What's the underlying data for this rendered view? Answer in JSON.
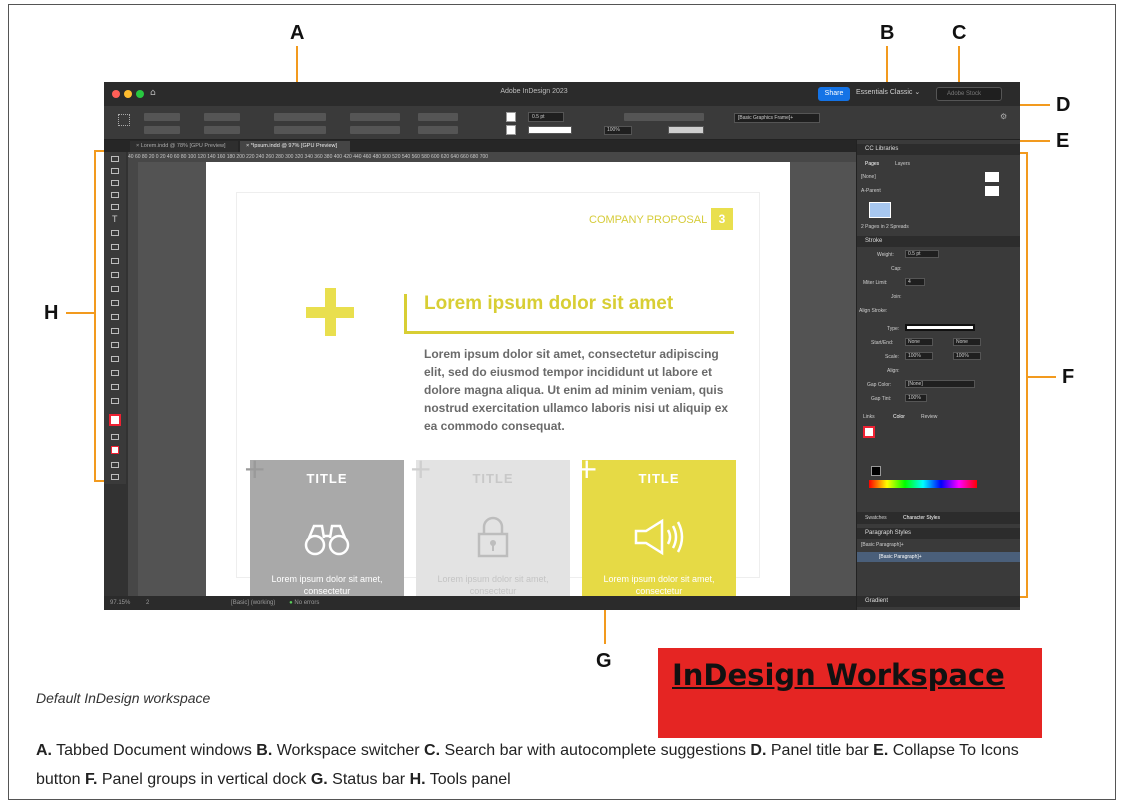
{
  "callouts": {
    "a": "A",
    "b": "B",
    "c": "C",
    "d": "D",
    "e": "E",
    "f": "F",
    "g": "G",
    "h": "H"
  },
  "app": {
    "title": "Adobe InDesign 2023",
    "share_label": "Share",
    "workspace": "Essentials Classic",
    "search_placeholder": "Adobe Stock",
    "tabs": [
      {
        "label": "Lorem.indd @ 78% [GPU Preview]"
      },
      {
        "label": "*Ipsum.indd @ 97% [GPU Preview]"
      }
    ],
    "ruler_labels": "40    60    80    20    0    20    40    60    80   100  120  140  160  180  200  220  240  260  280  300  320  340  360  380  400  420  440  460  480  500  520  540  560  580  600  620  640  660  680  700",
    "control": {
      "stroke_weight": "0.5 pt",
      "zoom_percent": "100%",
      "frame_style": "[Basic Graphics Frame]+"
    },
    "status": {
      "zoom": "97.15%",
      "page": "2",
      "style": "[Basic] (working)",
      "errors": "No errors"
    }
  },
  "dock": {
    "cc_libraries": "CC Libraries",
    "pages_tab": "Pages",
    "layers_tab": "Layers",
    "none_master": "[None]",
    "a_parent": "A-Parent",
    "pages_count": "2 Pages in 2 Spreads",
    "stroke_title": "Stroke",
    "weight_label": "Weight:",
    "weight_value": "0.5 pt",
    "cap_label": "Cap:",
    "miter_label": "Miter Limit:",
    "miter_value": "4",
    "join_label": "Join:",
    "align_label": "Align Stroke:",
    "type_label": "Type:",
    "startend_label": "Start/End:",
    "start_value": "None",
    "end_value": "None",
    "scale_label": "Scale:",
    "scale_value": "100%",
    "scale_value2": "100%",
    "align2_label": "Align:",
    "gap_color_label": "Gap Color:",
    "gap_color_value": "[None]",
    "gap_tint_label": "Gap Tint:",
    "gap_tint_value": "100%",
    "links_tab": "Links",
    "color_tab": "Color",
    "review_tab": "Review",
    "swatches_tab": "Swatches",
    "char_styles_tab": "Character Styles",
    "para_styles": "Paragraph Styles",
    "basic_para": "[Basic Paragraph]+",
    "basic_para2": "[Basic Paragraph]+",
    "gradient": "Gradient"
  },
  "document": {
    "company": "COMPANY PROPOSAL",
    "page_number": "3",
    "heading": "Lorem ipsum dolor sit amet",
    "body": "Lorem ipsum dolor sit amet, consectetur adipiscing elit, sed do eiusmod tempor incididunt ut labore et dolore magna aliqua. Ut enim ad minim veniam, quis nostrud exercitation ullamco laboris nisi ut aliquip ex ea commodo consequat.",
    "cards": [
      {
        "title": "TITLE",
        "text": "Lorem ipsum dolor sit amet, consectetur"
      },
      {
        "title": "TITLE",
        "text": "Lorem ipsum dolor sit amet, consectetur"
      },
      {
        "title": "TITLE",
        "text": "Lorem ipsum dolor sit amet, consectetur"
      }
    ]
  },
  "caption": "Default InDesign workspace",
  "overlay_title": "InDesign Workspace",
  "legend": [
    {
      "key": "A.",
      "text": " Tabbed Document windows "
    },
    {
      "key": "B.",
      "text": " Workspace switcher "
    },
    {
      "key": "C.",
      "text": " Search bar with autocomplete suggestions "
    },
    {
      "key": "D.",
      "text": " Panel title bar "
    },
    {
      "key": "E.",
      "text": " Collapse To Icons button "
    },
    {
      "key": "F.",
      "text": " Panel groups in vertical dock "
    },
    {
      "key": "G.",
      "text": " Status bar "
    },
    {
      "key": "H.",
      "text": " Tools panel"
    }
  ],
  "colors": {
    "accent_yellow": "#e9df4e",
    "callout_orange": "#f29a1e",
    "share_blue": "#1473e6",
    "overlay_red": "#e52523"
  }
}
